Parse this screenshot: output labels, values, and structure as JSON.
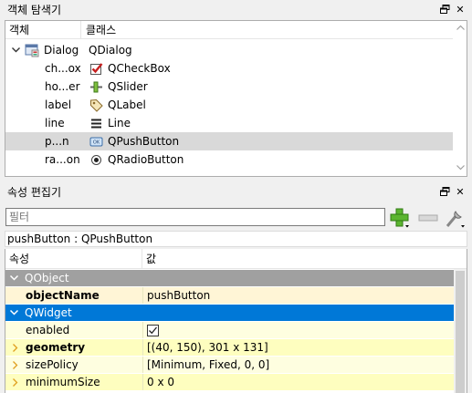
{
  "object_inspector": {
    "title": "객체 탐색기",
    "columns": [
      "객체",
      "클래스"
    ],
    "root": {
      "name": "Dialog",
      "class": "QDialog",
      "expanded": true
    },
    "children": [
      {
        "name": "ch...ox",
        "class": "QCheckBox",
        "icon": "checkbox-icon",
        "selected": false
      },
      {
        "name": "ho...er",
        "class": "QSlider",
        "icon": "slider-icon",
        "selected": false
      },
      {
        "name": "label",
        "class": "QLabel",
        "icon": "label-tag-icon",
        "selected": false
      },
      {
        "name": "line",
        "class": "Line",
        "icon": "line-icon",
        "selected": false
      },
      {
        "name": "p...n",
        "class": "QPushButton",
        "icon": "pushbutton-icon",
        "selected": true
      },
      {
        "name": "ra...on",
        "class": "QRadioButton",
        "icon": "radiobutton-icon",
        "selected": false
      }
    ]
  },
  "property_editor": {
    "title": "속성 편집기",
    "filter_placeholder": "필터",
    "class_label": "pushButton : QPushButton",
    "columns": [
      "속성",
      "값"
    ],
    "rows": [
      {
        "type": "group",
        "name": "QObject",
        "color": "#a0a0a0",
        "expanded": true
      },
      {
        "type": "prop",
        "name": "objectName",
        "value": "pushButton",
        "bold": true,
        "bg": "#fff5d6",
        "expandable": false
      },
      {
        "type": "group",
        "name": "QWidget",
        "color": "#0078d7",
        "expanded": true
      },
      {
        "type": "prop",
        "name": "enabled",
        "value": "",
        "checkbox": true,
        "checked": true,
        "bold": false,
        "bg": "#fefee0",
        "expandable": false
      },
      {
        "type": "prop",
        "name": "geometry",
        "value": "[(40, 150), 301 x 131]",
        "bold": true,
        "bg": "#fefebf",
        "expandable": true
      },
      {
        "type": "prop",
        "name": "sizePolicy",
        "value": "[Minimum, Fixed, 0, 0]",
        "bold": false,
        "bg": "#fefee0",
        "expandable": true
      },
      {
        "type": "prop",
        "name": "minimumSize",
        "value": "0 x 0",
        "bold": false,
        "bg": "#fefebf",
        "expandable": true
      }
    ]
  }
}
